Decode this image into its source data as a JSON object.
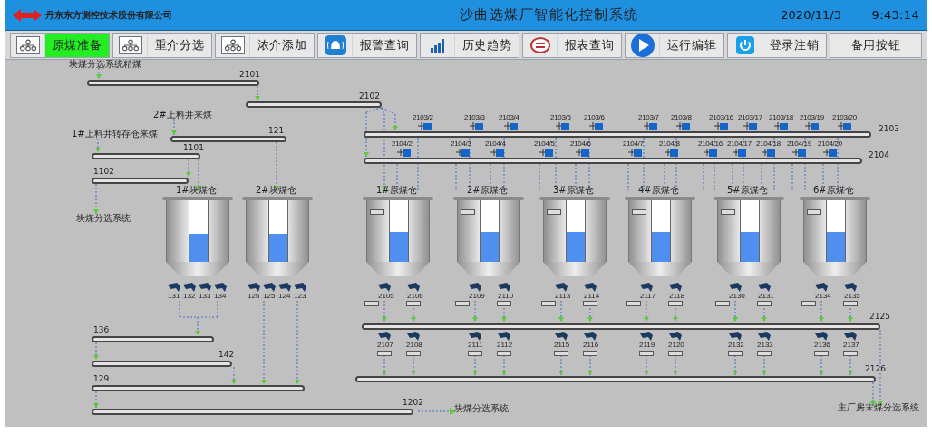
{
  "header": {
    "company": "丹东东方测控技术股份有限公司",
    "title": "沙曲选煤厂智能化控制系统",
    "date": "2020/11/3",
    "time": "9:43:14"
  },
  "toolbar": [
    {
      "label": "原煤准备",
      "selected": true
    },
    {
      "label": "重介分选",
      "selected": false
    },
    {
      "label": "浓介添加",
      "selected": false
    },
    {
      "label": "报警查询",
      "selected": false
    },
    {
      "label": "历史趋势",
      "selected": false
    },
    {
      "label": "报表查询",
      "selected": false
    },
    {
      "label": "运行编辑",
      "selected": false
    },
    {
      "label": "登录注销",
      "selected": false
    },
    {
      "label": "备用按钮",
      "selected": false
    }
  ],
  "diagram": {
    "sources": [
      "块煤分选系统精煤",
      "2#上料井来煤",
      "1#上料井转存仓来煤",
      "块煤分选系统",
      "块煤分选系统",
      "主厂房末煤分选系统"
    ],
    "conveyors": [
      "2101",
      "2102",
      "121",
      "1101",
      "1102",
      "2103",
      "2104",
      "2125",
      "2126",
      "136",
      "142",
      "129",
      "1202"
    ],
    "gates": [
      "2103/2",
      "2103/3",
      "2103/4",
      "2103/5",
      "2103/6",
      "2103/7",
      "2103/8",
      "2103/16",
      "2103/17",
      "2103/18",
      "2103/19",
      "2103/20",
      "2104/2",
      "2104/3",
      "2104/4",
      "2104/5",
      "2104/6",
      "2104/7",
      "2104/8",
      "2104/16",
      "2104/17",
      "2104/18",
      "2104/19",
      "2104/20"
    ],
    "bins": [
      {
        "label": "1#块煤仓",
        "level": 0.45,
        "feeders": [
          "131",
          "132",
          "133",
          "134"
        ]
      },
      {
        "label": "2#块煤仓",
        "level": 0.45,
        "feeders": [
          "126",
          "125",
          "124",
          "123"
        ]
      },
      {
        "label": "1#原煤仓",
        "level": 0.48,
        "feeders": [
          "2105",
          "2106"
        ]
      },
      {
        "label": "2#原煤仓",
        "level": 0.48,
        "feeders": [
          "2109",
          "2110"
        ]
      },
      {
        "label": "3#原煤仓",
        "level": 0.48,
        "feeders": [
          "2113",
          "2114"
        ]
      },
      {
        "label": "4#原煤仓",
        "level": 0.48,
        "feeders": [
          "2117",
          "2118"
        ]
      },
      {
        "label": "5#原煤仓",
        "level": 0.48,
        "feeders": [
          "2130",
          "2131"
        ]
      },
      {
        "label": "6#原煤仓",
        "level": 0.48,
        "feeders": [
          "2134",
          "2135"
        ]
      }
    ],
    "lower_feeders": [
      "2107",
      "2108",
      "2111",
      "2112",
      "2115",
      "2116",
      "2119",
      "2120",
      "2132",
      "2133",
      "2136",
      "2137"
    ]
  }
}
